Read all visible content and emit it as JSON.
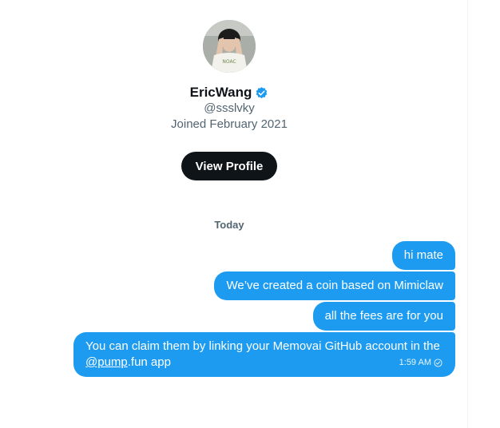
{
  "profile": {
    "name": "EricWang",
    "handle": "@ssslvky",
    "joined": "Joined February 2021",
    "avatar_shirt_text": "NOAC",
    "view_profile_label": "View Profile",
    "verified_icon": "verified-badge-icon"
  },
  "conversation": {
    "date_separator": "Today",
    "messages": [
      {
        "text": "hi mate"
      },
      {
        "text": "We’ve created a coin based on Mimiclaw"
      },
      {
        "text": "all the fees are for you"
      },
      {
        "text_before_link": "You can claim them by linking your Memovai GitHub account in the ",
        "link_text": "@pump",
        "text_after_link": ".fun app",
        "time": "1:59 AM",
        "status_icon": "sent-check-icon"
      }
    ]
  },
  "colors": {
    "bubble": "#1d9bf0",
    "button": "#0f1419",
    "secondary_text": "#536471",
    "verified": "#1d9bf0"
  }
}
